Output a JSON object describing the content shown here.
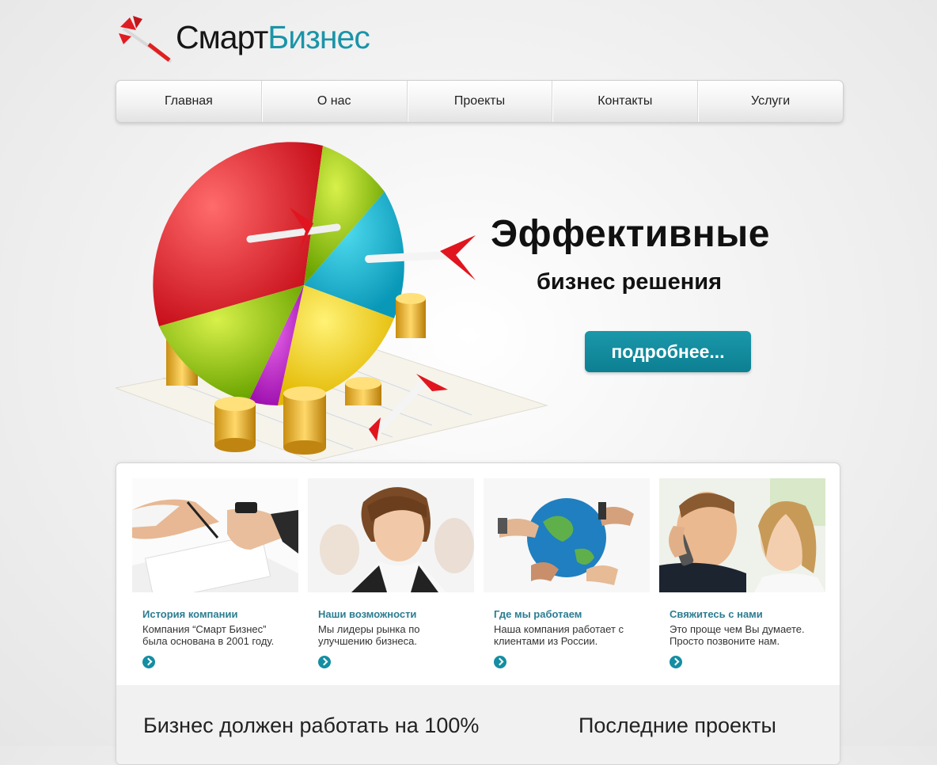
{
  "logo": {
    "part1": "Смарт",
    "part2": "Бизнес"
  },
  "nav": [
    {
      "label": "Главная"
    },
    {
      "label": "О нас"
    },
    {
      "label": "Проекты"
    },
    {
      "label": "Контакты"
    },
    {
      "label": "Услуги"
    }
  ],
  "hero": {
    "title": "Эффективные",
    "subtitle": "бизнес решения",
    "button": "подробнее..."
  },
  "cards": [
    {
      "title": "История компании",
      "text": "Компания “Смарт Бизнес” была основана в 2001 году."
    },
    {
      "title": "Наши возможности",
      "text": "Мы лидеры рынка по улучшению бизнеса."
    },
    {
      "title": "Где мы работаем",
      "text": "Наша компания работает с клиентами из России."
    },
    {
      "title": "Свяжитесь с нами",
      "text": "Это проще чем Вы думаете. Просто позвоните нам."
    }
  ],
  "bottom": {
    "left_heading": "Бизнес должен работать на 100%",
    "right_heading": "Последние проекты"
  },
  "colors": {
    "accent": "#1a94a8",
    "button": "#0d7f92",
    "card_title": "#2c7d91"
  }
}
